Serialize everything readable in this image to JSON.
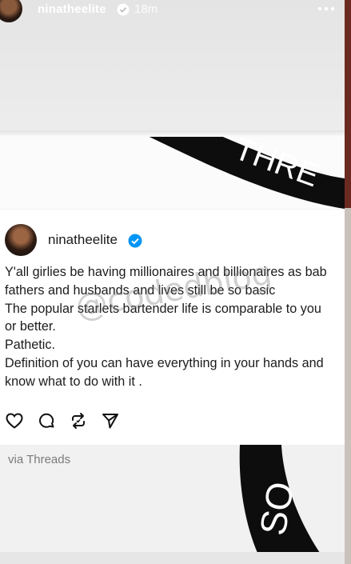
{
  "story": {
    "username": "ninatheelite",
    "time": "18m",
    "more_icon": "more-horizontal-icon"
  },
  "top_card": {
    "banner_text": "THRE"
  },
  "post": {
    "username": "ninatheelite",
    "verified_icon": "verified-badge-icon",
    "lines": [
      "Y'all girlies be having millionaires and billionaires as bab",
      "fathers and husbands and lives still be so basic",
      "The popular starlets bartender life is comparable to you",
      "or better.",
      "Pathetic.",
      "Definition of you can have everything in your hands and",
      "know what to do with it ."
    ],
    "actions": [
      "heart-icon",
      "comment-icon",
      "repost-icon",
      "share-icon"
    ]
  },
  "watermark": "@codedblog",
  "via_text": "via Threads",
  "bottom_banner_text": "SO",
  "colors": {
    "verified": "#0095f6",
    "text": "#1c1c1c",
    "banner": "#0d0d0d"
  }
}
